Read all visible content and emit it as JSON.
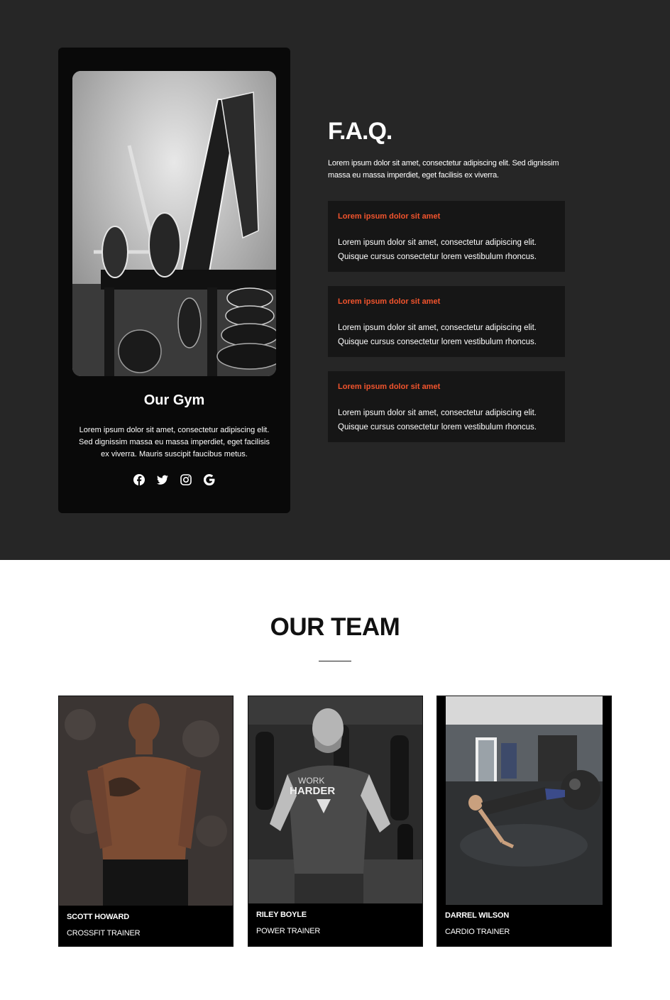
{
  "gym_card": {
    "title": "Our Gym",
    "text": "Lorem ipsum dolor sit amet, consectetur adipiscing elit. Sed dignissim massa eu massa imperdiet, eget facilisis ex viverra. Mauris suscipit faucibus metus.",
    "social_icons": [
      "facebook-icon",
      "twitter-icon",
      "instagram-icon",
      "google-icon"
    ]
  },
  "faq": {
    "title": "F.A.Q.",
    "intro": "Lorem ipsum dolor sit amet, consectetur adipiscing elit. Sed dignissim massa eu massa imperdiet, eget facilisis ex viverra.",
    "items": [
      {
        "question": "Lorem ipsum dolor sit amet",
        "answer": "Lorem ipsum dolor sit amet, consectetur adipiscing elit. Quisque cursus consectetur lorem vestibulum rhoncus."
      },
      {
        "question": "Lorem ipsum dolor sit amet",
        "answer": "Lorem ipsum dolor sit amet, consectetur adipiscing elit. Quisque cursus consectetur lorem vestibulum rhoncus."
      },
      {
        "question": "Lorem ipsum dolor sit amet",
        "answer": "Lorem ipsum dolor sit amet, consectetur adipiscing elit. Quisque cursus consectetur lorem vestibulum rhoncus."
      }
    ]
  },
  "team": {
    "title": "OUR TEAM",
    "members": [
      {
        "name": "SCOTT HOWARD",
        "role": "CROSSFIT TRAINER"
      },
      {
        "name": "RILEY BOYLE",
        "role": "POWER TRAINER",
        "shirt_text_1": "WORK",
        "shirt_text_2": "HARDER"
      },
      {
        "name": "DARREL WILSON",
        "role": "CARDIO TRAINER"
      }
    ]
  },
  "colors": {
    "dark_bg": "#262626",
    "card_bg": "#090909",
    "faq_item_bg": "#161616",
    "accent": "#f2542d"
  }
}
